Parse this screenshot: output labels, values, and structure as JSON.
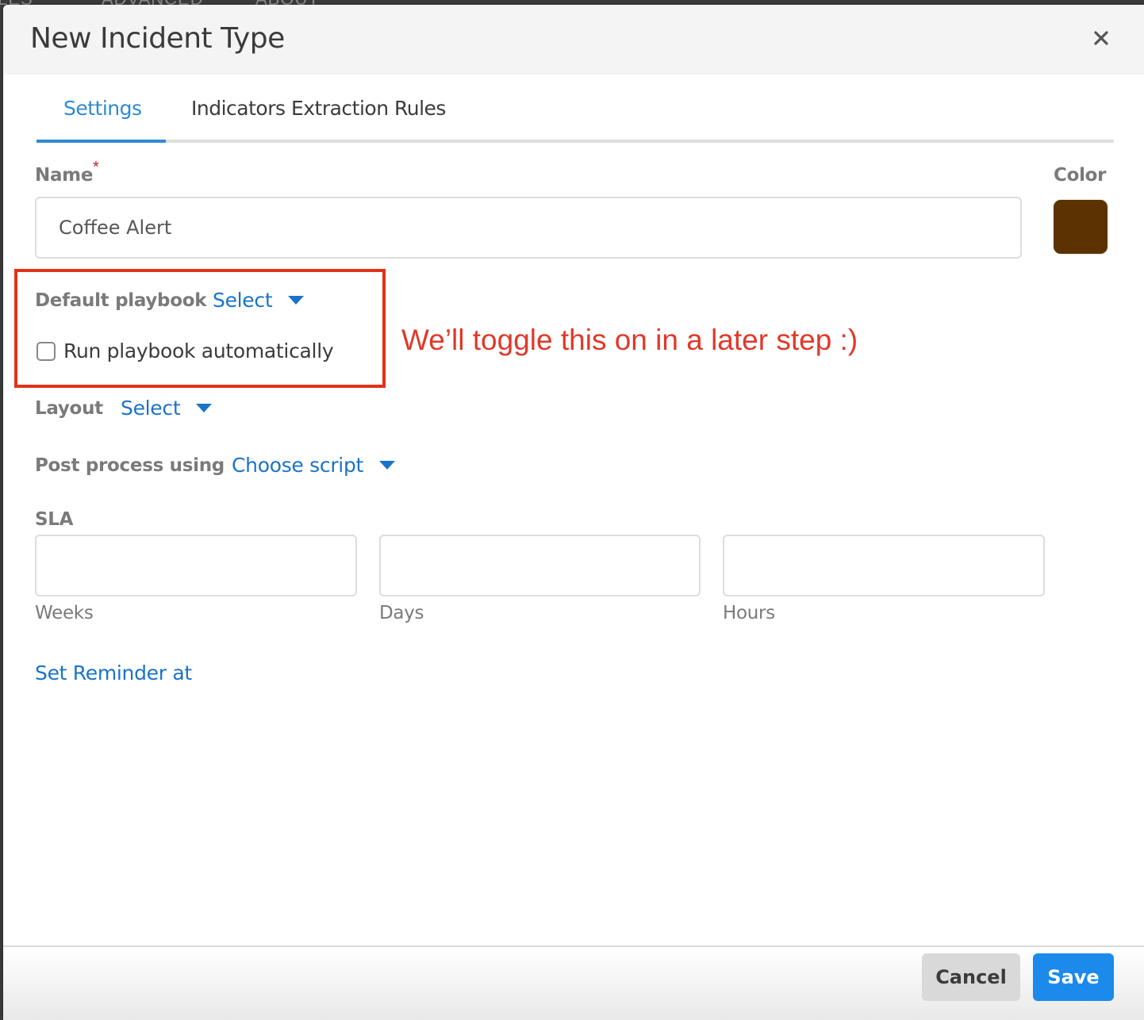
{
  "background": {
    "nav_items": [
      "ILES",
      "ADVANCED",
      "ABOUT"
    ]
  },
  "dialog": {
    "title": "New Incident Type",
    "close_icon": "close-icon"
  },
  "tabs": [
    {
      "label": "Settings",
      "active": true
    },
    {
      "label": "Indicators Extraction Rules",
      "active": false
    }
  ],
  "form": {
    "name": {
      "label": "Name",
      "required_marker": "*",
      "value": "Coffee Alert",
      "placeholder": ""
    },
    "color": {
      "label": "Color",
      "value": "#5c3200"
    },
    "default_playbook": {
      "label": "Default playbook",
      "selected": "Select"
    },
    "run_playbook_automatically": {
      "label": "Run playbook automatically",
      "checked": false
    },
    "layout": {
      "label": "Layout",
      "selected": "Select"
    },
    "post_process": {
      "label": "Post process using",
      "selected": "Choose script"
    },
    "sla": {
      "label": "SLA",
      "fields": [
        {
          "label": "Weeks",
          "value": ""
        },
        {
          "label": "Days",
          "value": ""
        },
        {
          "label": "Hours",
          "value": ""
        }
      ]
    },
    "set_reminder_link": "Set Reminder at"
  },
  "annotation": {
    "text": "We’ll toggle this on in a later step :)",
    "color": "#e2321a"
  },
  "footer": {
    "cancel_label": "Cancel",
    "save_label": "Save"
  },
  "colors": {
    "accent": "#2d8ad6",
    "link": "#1a73c9",
    "primary_button": "#1b8aea"
  }
}
